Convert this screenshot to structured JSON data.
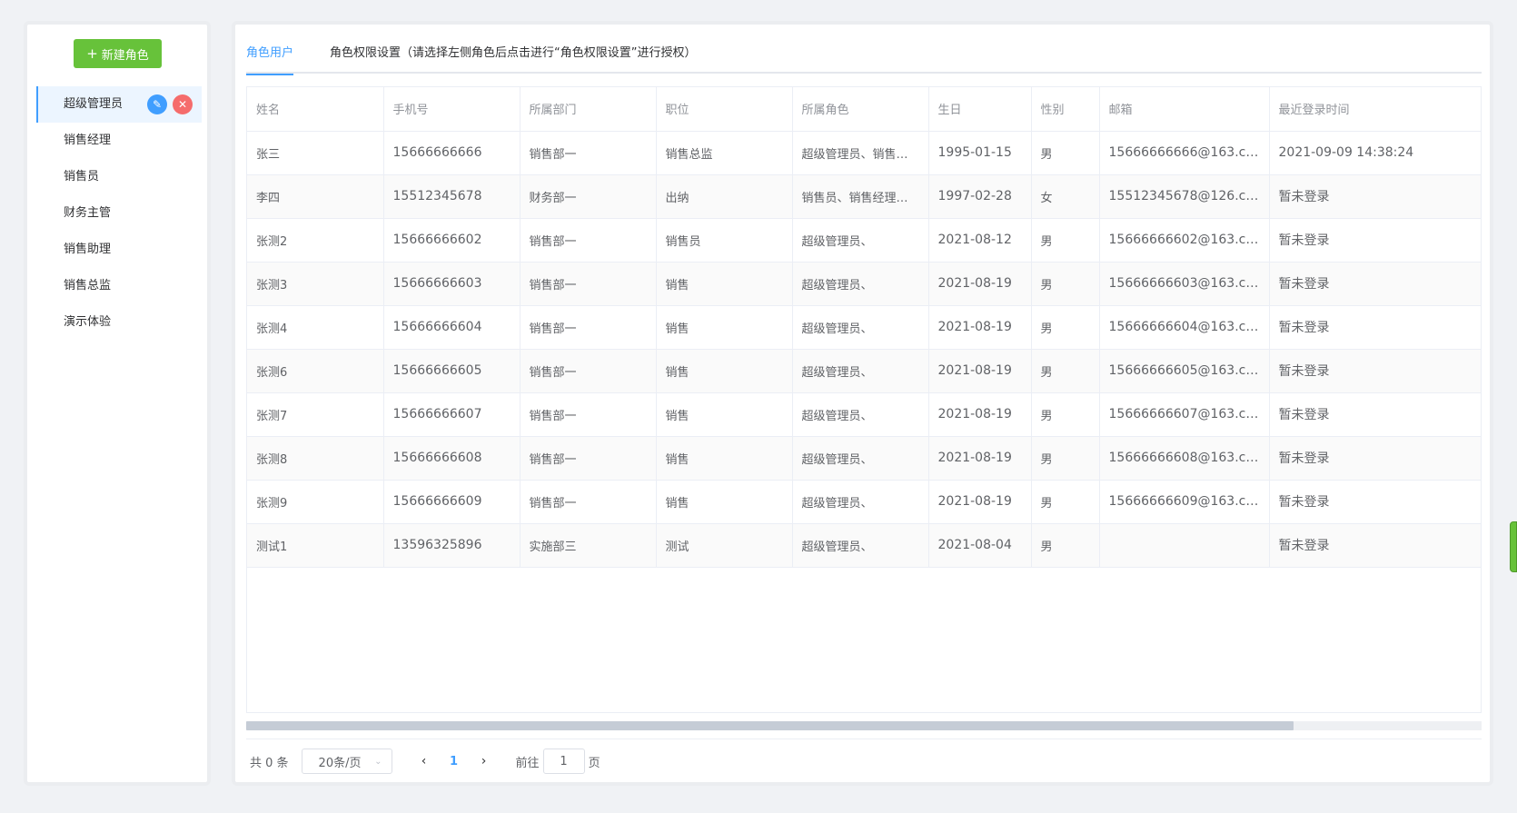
{
  "sidebar": {
    "new_role_label": "新建角色",
    "roles": [
      {
        "label": "超级管理员",
        "active": true
      },
      {
        "label": "销售经理",
        "active": false
      },
      {
        "label": "销售员",
        "active": false
      },
      {
        "label": "财务主管",
        "active": false
      },
      {
        "label": "销售助理",
        "active": false
      },
      {
        "label": "销售总监",
        "active": false
      },
      {
        "label": "演示体验",
        "active": false
      }
    ]
  },
  "tabs": [
    {
      "label": "角色用户",
      "active": true
    },
    {
      "label": "角色权限设置（请选择左侧角色后点击进行“角色权限设置”进行授权）",
      "active": false
    }
  ],
  "table": {
    "columns": [
      "姓名",
      "手机号",
      "所属部门",
      "职位",
      "所属角色",
      "生日",
      "性别",
      "邮箱",
      "最近登录时间"
    ],
    "rows": [
      [
        "张三",
        "15666666666",
        "销售部一",
        "销售总监",
        "超级管理员、销售经…",
        "1995-01-15",
        "男",
        "15666666666@163.com",
        "2021-09-09 14:38:24"
      ],
      [
        "李四",
        "15512345678",
        "财务部一",
        "出纳",
        "销售员、销售经理、…",
        "1997-02-28",
        "女",
        "15512345678@126.com",
        "暂未登录"
      ],
      [
        "张测2",
        "15666666602",
        "销售部一",
        "销售员",
        "超级管理员、",
        "2021-08-12",
        "男",
        "15666666602@163.com",
        "暂未登录"
      ],
      [
        "张测3",
        "15666666603",
        "销售部一",
        "销售",
        "超级管理员、",
        "2021-08-19",
        "男",
        "15666666603@163.com",
        "暂未登录"
      ],
      [
        "张测4",
        "15666666604",
        "销售部一",
        "销售",
        "超级管理员、",
        "2021-08-19",
        "男",
        "15666666604@163.com",
        "暂未登录"
      ],
      [
        "张测6",
        "15666666605",
        "销售部一",
        "销售",
        "超级管理员、",
        "2021-08-19",
        "男",
        "15666666605@163.com",
        "暂未登录"
      ],
      [
        "张测7",
        "15666666607",
        "销售部一",
        "销售",
        "超级管理员、",
        "2021-08-19",
        "男",
        "15666666607@163.com",
        "暂未登录"
      ],
      [
        "张测8",
        "15666666608",
        "销售部一",
        "销售",
        "超级管理员、",
        "2021-08-19",
        "男",
        "15666666608@163.com",
        "暂未登录"
      ],
      [
        "张测9",
        "15666666609",
        "销售部一",
        "销售",
        "超级管理员、",
        "2021-08-19",
        "男",
        "15666666609@163.com",
        "暂未登录"
      ],
      [
        "测试1",
        "13596325896",
        "实施部三",
        "测试",
        "超级管理员、",
        "2021-08-04",
        "男",
        "",
        "暂未登录"
      ]
    ]
  },
  "pagination": {
    "total_label": "共 0 条",
    "page_size": "20条/页",
    "current_page": "1",
    "goto_label": "前往",
    "goto_value": "1",
    "page_suffix": "页"
  },
  "icons": {
    "add": "plus-icon",
    "edit": "pencil-icon",
    "delete": "close-icon",
    "prev": "chevron-left-icon",
    "next": "chevron-right-icon",
    "dropdown": "chevron-down-icon"
  },
  "colors": {
    "primary": "#409eff",
    "success": "#67c23a",
    "danger": "#f56c6c"
  }
}
